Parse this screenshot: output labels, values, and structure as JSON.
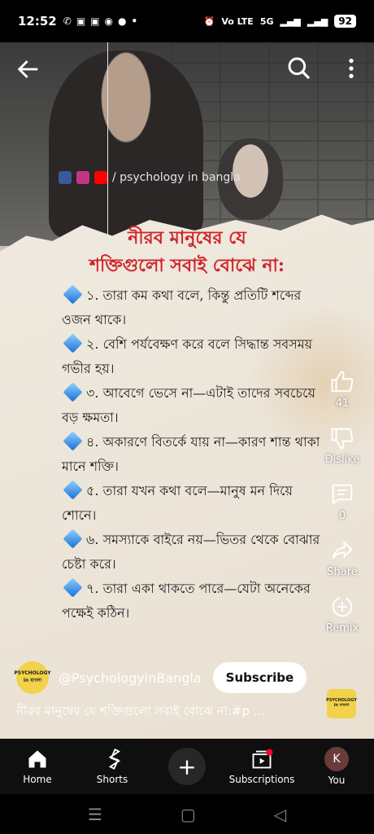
{
  "status_bar": {
    "time": "12:52",
    "network_label": "Vo LTE",
    "signal_label": "5G",
    "battery": "92"
  },
  "video": {
    "watermark": "/ psychology in bangla",
    "title_lines": [
      "নীরব মানুষের যে",
      "শক্তিগুলো সবাই বোঝে না:"
    ],
    "points": [
      "১. তারা কম কথা বলে, কিন্তু প্রতিটি শব্দের ওজন থাকে।",
      "২. বেশি পর্যবেক্ষণ করে বলে সিদ্ধান্ত সবসময় গভীর হয়।",
      "৩. আবেগে ভেসে না—এটাই তাদের সবচেয়ে বড় ক্ষমতা।",
      "৪. অকারণে বিতর্কে যায় না—কারণ শান্ত থাকা মানে শক্তি।",
      "৫. তারা যখন কথা বলে—মানুষ মন দিয়ে শোনে।",
      "৬. সমস্যাকে বাইরে নয়—ভিতর থেকে বোঝার চেষ্টা করে।",
      "৭. তারা একা থাকতে পারে—যেটা অনেকের পক্ষেই কঠিন।"
    ]
  },
  "actions": {
    "like_count": "41",
    "dislike_label": "Dislike",
    "comment_count": "0",
    "share_label": "Share",
    "remix_label": "Remix"
  },
  "channel": {
    "avatar_text_top": "PSYCHOLOGY",
    "avatar_text_bottom": "in বাংলা",
    "name": "@PsychologyinBangla",
    "subscribe_label": "Subscribe",
    "caption": "নীরব মানুষের যে শক্তিগুলো সবাই বোঝে না:#p ..."
  },
  "bottom_nav": {
    "home": "Home",
    "shorts": "Shorts",
    "subscriptions": "Subscriptions",
    "you": "You",
    "you_initial": "K"
  },
  "colors": {
    "title_red": "#d0242a",
    "accent_red": "#ff0033"
  }
}
